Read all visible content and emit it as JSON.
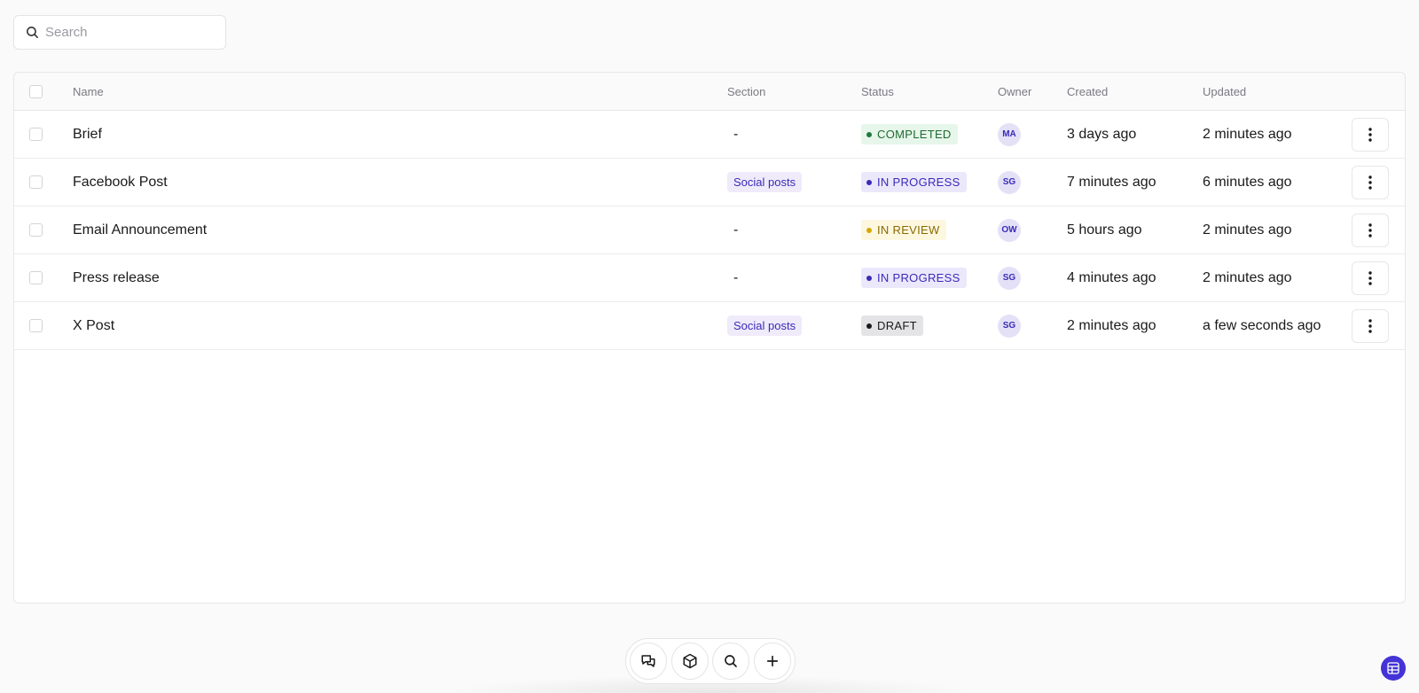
{
  "search": {
    "placeholder": "Search",
    "value": ""
  },
  "table": {
    "headers": {
      "name": "Name",
      "section": "Section",
      "status": "Status",
      "owner": "Owner",
      "created": "Created",
      "updated": "Updated"
    },
    "rows": [
      {
        "name": "Brief",
        "section": "-",
        "section_is_tag": false,
        "status": "COMPLETED",
        "status_kind": "completed",
        "owner": "MA",
        "created": "3 days ago",
        "updated": "2 minutes ago"
      },
      {
        "name": "Facebook Post",
        "section": "Social posts",
        "section_is_tag": true,
        "status": "IN PROGRESS",
        "status_kind": "in-progress",
        "owner": "SG",
        "created": "7 minutes ago",
        "updated": "6 minutes ago"
      },
      {
        "name": "Email Announcement",
        "section": "-",
        "section_is_tag": false,
        "status": "IN REVIEW",
        "status_kind": "in-review",
        "owner": "OW",
        "created": "5 hours ago",
        "updated": "2 minutes ago"
      },
      {
        "name": "Press release",
        "section": "-",
        "section_is_tag": false,
        "status": "IN PROGRESS",
        "status_kind": "in-progress",
        "owner": "SG",
        "created": "4 minutes ago",
        "updated": "2 minutes ago"
      },
      {
        "name": "X Post",
        "section": "Social posts",
        "section_is_tag": true,
        "status": "DRAFT",
        "status_kind": "draft",
        "owner": "SG",
        "created": "2 minutes ago",
        "updated": "a few seconds ago"
      }
    ]
  },
  "status_colors": {
    "completed": {
      "bg": "#e7f6ea",
      "fg": "#1f6b33",
      "dot": "#1f7a3a"
    },
    "in-progress": {
      "bg": "#ece8fb",
      "fg": "#3a2bb8",
      "dot": "#3a2bb8"
    },
    "in-review": {
      "bg": "#fdf7e0",
      "fg": "#8a6a00",
      "dot": "#d4a800"
    },
    "draft": {
      "bg": "#e4e4e7",
      "fg": "#1a1a1a",
      "dot": "#1a1a1a"
    }
  },
  "toolbar": {
    "buttons": [
      {
        "icon": "chat-bubbles-icon"
      },
      {
        "icon": "cube-icon"
      },
      {
        "icon": "search-icon"
      },
      {
        "icon": "plus-icon"
      }
    ]
  },
  "corner_button": {
    "icon": "table-grid-icon",
    "color": "#4433d6"
  },
  "accent": "#4433d6"
}
